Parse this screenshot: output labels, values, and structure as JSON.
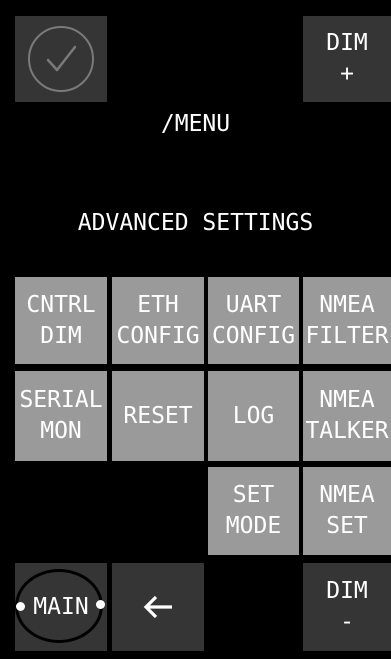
{
  "header": {
    "check_icon": "check-circle-icon",
    "path": "/MENU",
    "dim_up_label": "DIM\n+"
  },
  "section": {
    "title": "ADVANCED SETTINGS"
  },
  "menu": {
    "cntrl_dim": "CNTRL\nDIM",
    "eth_config": "ETH\nCONFIG",
    "uart_config": "UART\nCONFIG",
    "nmea_filter": "NMEA\nFILTER",
    "serial_mon": "SERIAL\nMON",
    "reset": "RESET",
    "log": "LOG",
    "nmea_talker": "NMEA\nTALKER",
    "set_mode": "SET\nMODE",
    "nmea_set": "NMEA\nSET"
  },
  "footer": {
    "main_label": "MAIN",
    "back_icon": "left-arrow-icon",
    "dim_down_label": "DIM\n-"
  },
  "colors": {
    "background": "#000000",
    "dark_tile": "#353535",
    "light_tile": "#9a9a9a",
    "text": "#ffffff"
  }
}
